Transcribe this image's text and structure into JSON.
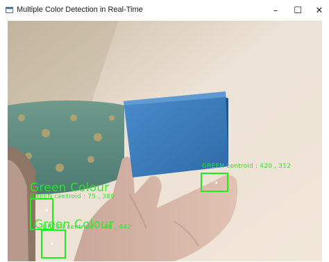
{
  "window": {
    "title": "Multiple Color Detection in Real-Time",
    "icon": "app-window-icon",
    "controls": {
      "minimize": "–",
      "maximize": "☐",
      "close": "✕"
    }
  },
  "detections": {
    "big_label_1": "Green Colour",
    "big_label_2": "Green Colour",
    "centroid_label_1": "GREEN centroid : 75 , 380",
    "centroid_label_2": "GREEN centroid : 108 , 442",
    "centroid_label_3": "GREEN centroid : 420 , 312"
  },
  "colors": {
    "detection": "#22ee22",
    "box_blue": "#3b7fbf",
    "wall": "#e9dccb"
  }
}
